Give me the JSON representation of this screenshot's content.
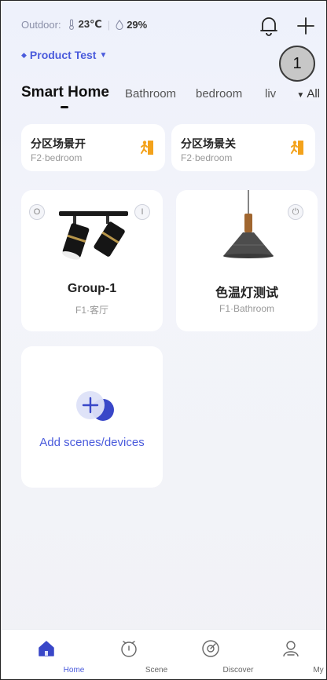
{
  "header": {
    "outdoor_label": "Outdoor:",
    "temperature": "23℃",
    "humidity": "29%"
  },
  "home": {
    "name": "Product Test"
  },
  "callout": "1",
  "tabs": {
    "items": [
      "Smart Home",
      "Bathroom",
      "bedroom",
      "liv"
    ],
    "more_label": "All"
  },
  "scenes": [
    {
      "title": "分区场景开",
      "room": "F2·bedroom"
    },
    {
      "title": "分区场景关",
      "room": "F2·bedroom"
    }
  ],
  "devices": [
    {
      "title": "Group-1",
      "room": "F1·客厅",
      "off_symbol": "O",
      "on_symbol": "I"
    },
    {
      "title": "色温灯测试",
      "room": "F1·Bathroom"
    }
  ],
  "add_card": {
    "label": "Add scenes/devices"
  },
  "nav": [
    {
      "label": "Home",
      "icon": "home-icon"
    },
    {
      "label": "Scene",
      "icon": "scene-icon"
    },
    {
      "label": "Discover",
      "icon": "discover-icon"
    },
    {
      "label": "My",
      "icon": "user-icon"
    }
  ],
  "colors": {
    "accent": "#4a5bdc",
    "scene_icon": "#f3a21b"
  }
}
